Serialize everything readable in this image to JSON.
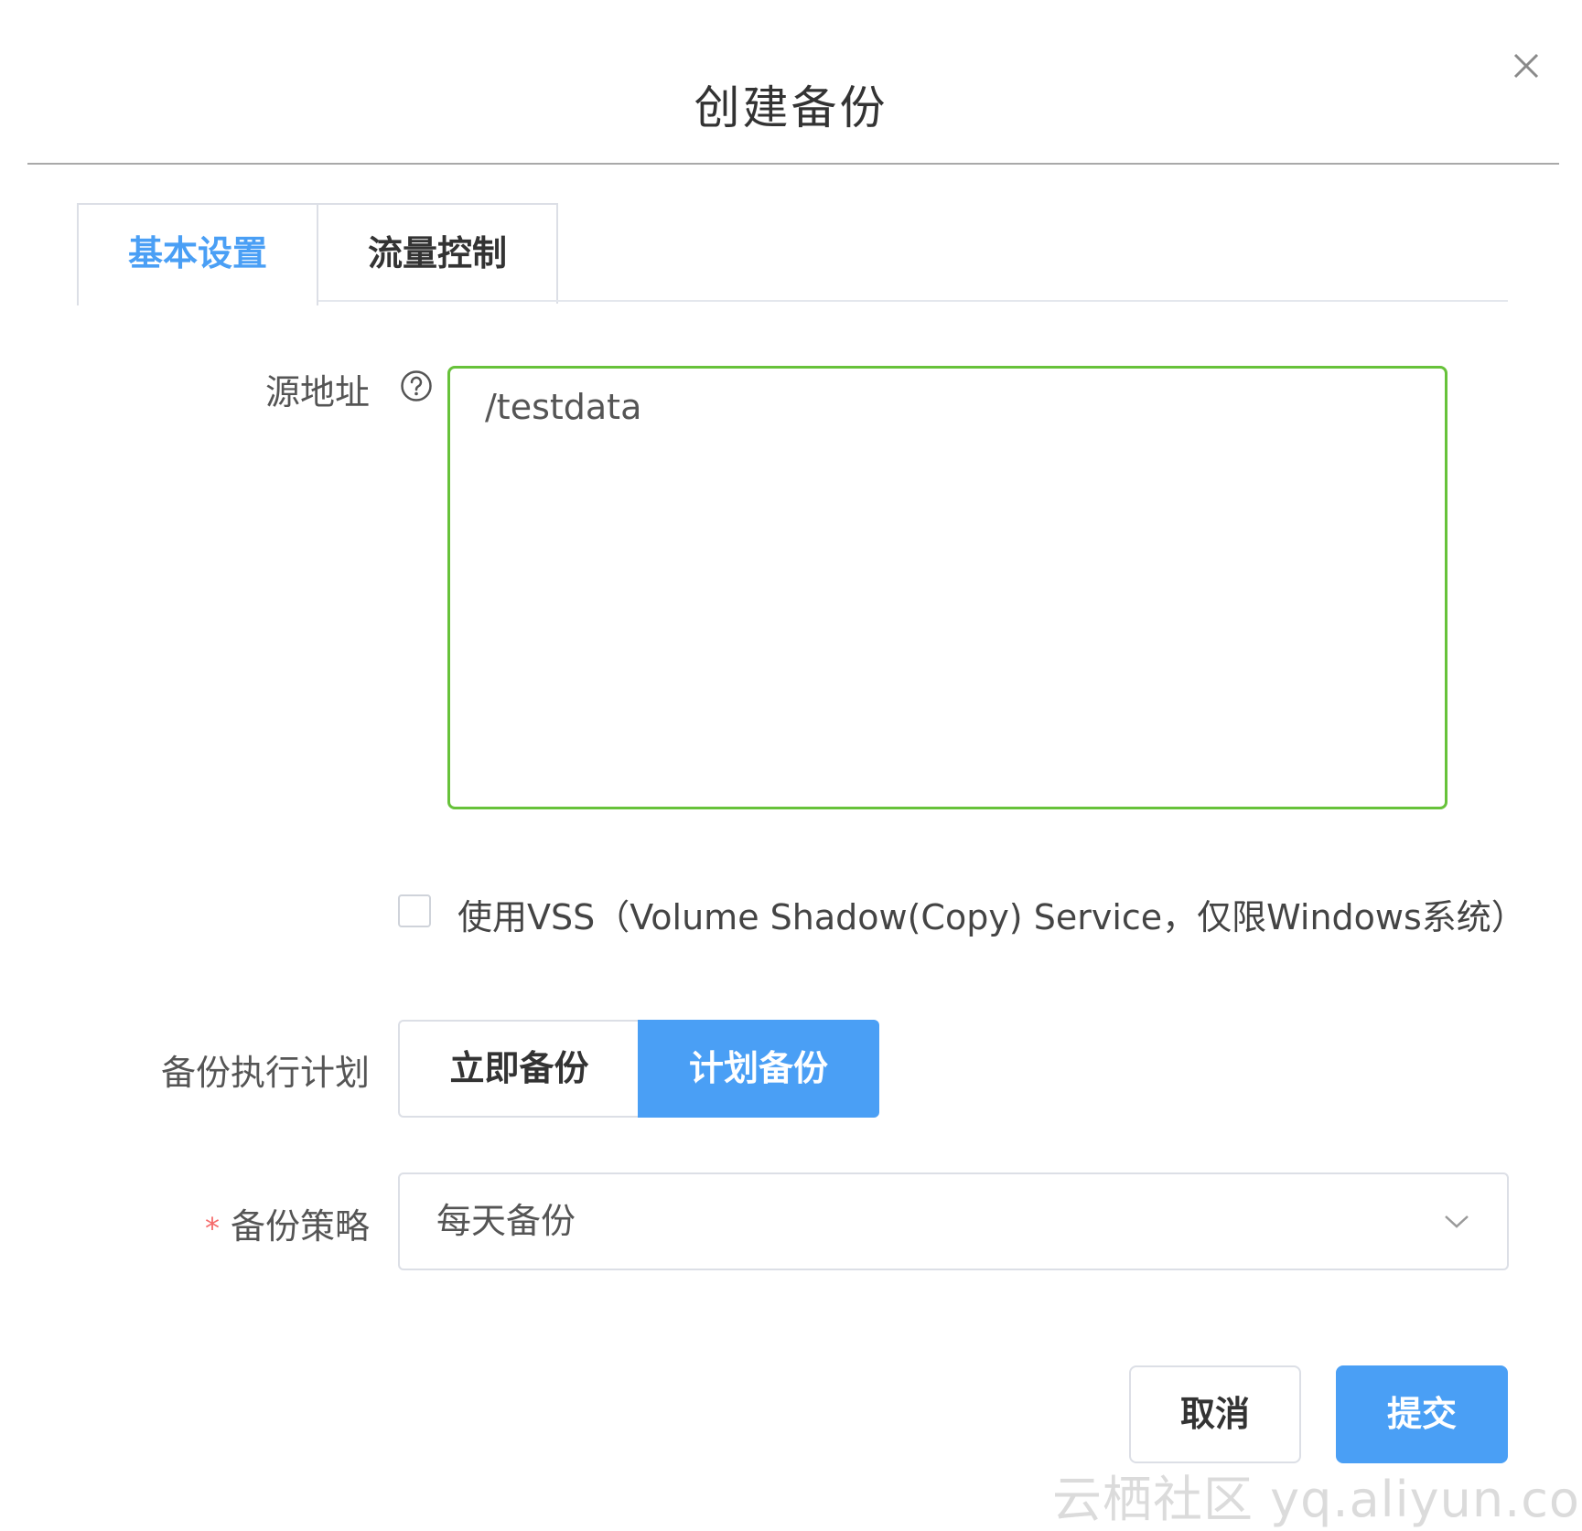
{
  "dialog": {
    "title": "创建备份",
    "close_icon": "close-icon"
  },
  "tabs": [
    {
      "label": "基本设置",
      "active": true
    },
    {
      "label": "流量控制",
      "active": false
    }
  ],
  "form": {
    "source": {
      "label": "源地址",
      "help_icon": "question-circle-icon",
      "value": "/testdata"
    },
    "vss": {
      "checked": false,
      "label": "使用VSS（Volume Shadow(Copy) Service，仅限Windows系统）"
    },
    "plan": {
      "label": "备份执行计划",
      "options": [
        {
          "label": "立即备份",
          "selected": false
        },
        {
          "label": "计划备份",
          "selected": true
        }
      ]
    },
    "strategy": {
      "required_mark": "*",
      "label": "备份策略",
      "value": "每天备份",
      "dropdown_icon": "chevron-down-icon"
    }
  },
  "footer": {
    "cancel_label": "取消",
    "submit_label": "提交"
  },
  "watermark": "云栖社区 yq.aliyun.com",
  "colors": {
    "primary": "#4a9ff5",
    "valid_border": "#67c23a",
    "required": "#f56c6c",
    "border": "#dcdfe6"
  }
}
